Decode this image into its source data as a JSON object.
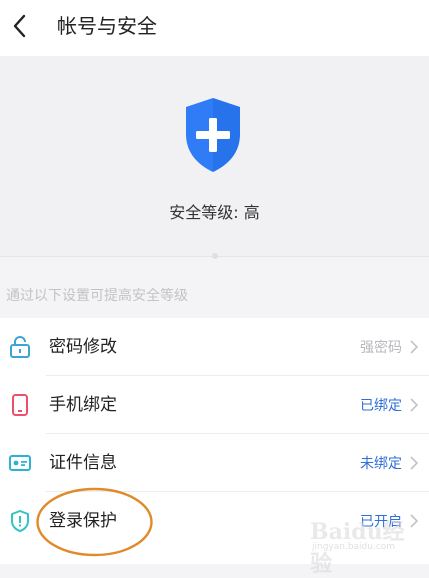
{
  "header": {
    "title": "帐号与安全",
    "back_icon": "chevron-left-icon"
  },
  "hero": {
    "shield_icon": "shield-plus-icon",
    "shield_color": "#2f7cf6",
    "security_level": "安全等级: 高"
  },
  "hint": "通过以下设置可提高安全等级",
  "items": [
    {
      "icon": "lock-icon",
      "icon_color": "#3aa4d6",
      "label": "密码修改",
      "status": "强密码",
      "status_color": "#b8b8bc"
    },
    {
      "icon": "phone-icon",
      "icon_color": "#ef4f6c",
      "label": "手机绑定",
      "status": "已绑定",
      "status_color": "#2f6fd8"
    },
    {
      "icon": "id-card-icon",
      "icon_color": "#2bb3d6",
      "label": "证件信息",
      "status": "未绑定",
      "status_color": "#2f6fd8"
    },
    {
      "icon": "shield-alert-icon",
      "icon_color": "#2ec5c5",
      "label": "登录保护",
      "status": "已开启",
      "status_color": "#2f6fd8"
    }
  ],
  "annotation": {
    "color": "#e08a2a"
  },
  "watermark": {
    "text": "Baidu经验",
    "url": "jingyan.baidu.com"
  }
}
